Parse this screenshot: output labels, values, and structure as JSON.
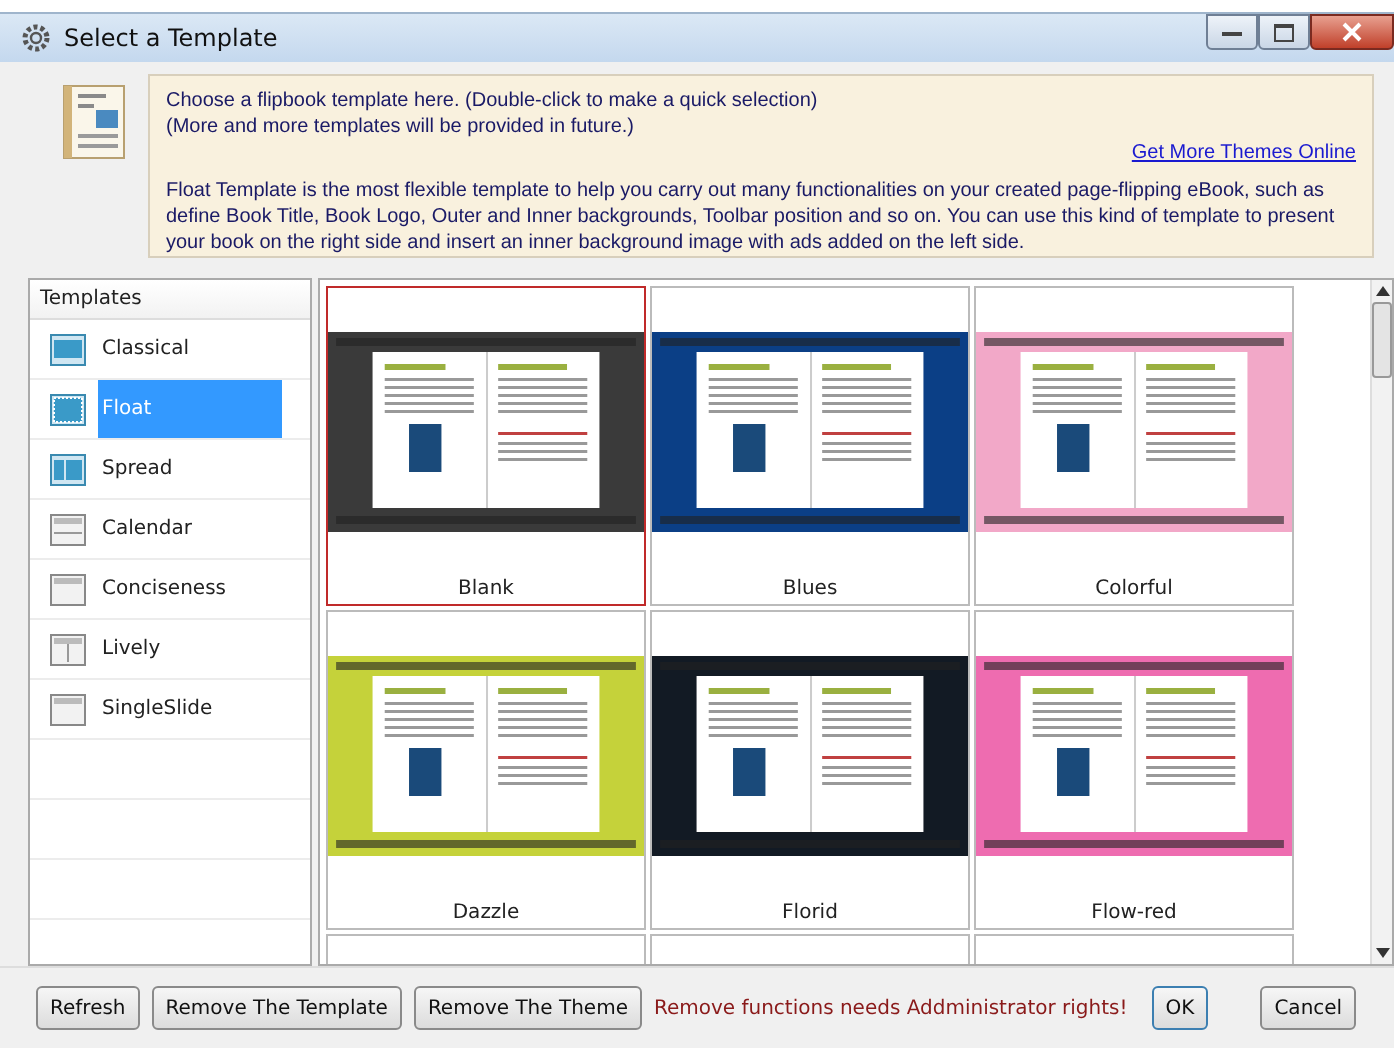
{
  "window": {
    "title": "Select a Template"
  },
  "info": {
    "lines": [
      "Choose a flipbook template here. (Double-click to make a quick selection)",
      "(More and more templates will be provided in future.)"
    ],
    "link": "Get More Themes Online",
    "description": "Float Template is the most flexible template to help you carry out many functionalities on your created page-flipping eBook, such as define Book Title, Book Logo, Outer and Inner backgrounds, Toolbar position and so on. You can use this kind of template to present your book on the right side and insert an inner background image with ads added on the left side."
  },
  "sidebar": {
    "heading": "Templates",
    "items": [
      {
        "label": "Classical",
        "selected": false
      },
      {
        "label": "Float",
        "selected": true
      },
      {
        "label": "Spread",
        "selected": false
      },
      {
        "label": "Calendar",
        "selected": false
      },
      {
        "label": "Conciseness",
        "selected": false
      },
      {
        "label": "Lively",
        "selected": false
      },
      {
        "label": "SingleSlide",
        "selected": false
      }
    ]
  },
  "themes": [
    {
      "name": "Blank",
      "selected": true,
      "color": "#3a3a3a"
    },
    {
      "name": "Blues",
      "selected": false,
      "color": "#0b3f86"
    },
    {
      "name": "Colorful",
      "selected": false,
      "color": "#f2a8c8"
    },
    {
      "name": "Dazzle",
      "selected": false,
      "color": "#c5d23a"
    },
    {
      "name": "Florid",
      "selected": false,
      "color": "#121a24"
    },
    {
      "name": "Flow-red",
      "selected": false,
      "color": "#ee6cb0"
    }
  ],
  "footer": {
    "buttons": [
      "Refresh",
      "Remove The Template",
      "Remove The Theme"
    ],
    "warning": "Remove functions needs Addministrator rights!",
    "ok": "OK",
    "cancel": "Cancel"
  }
}
